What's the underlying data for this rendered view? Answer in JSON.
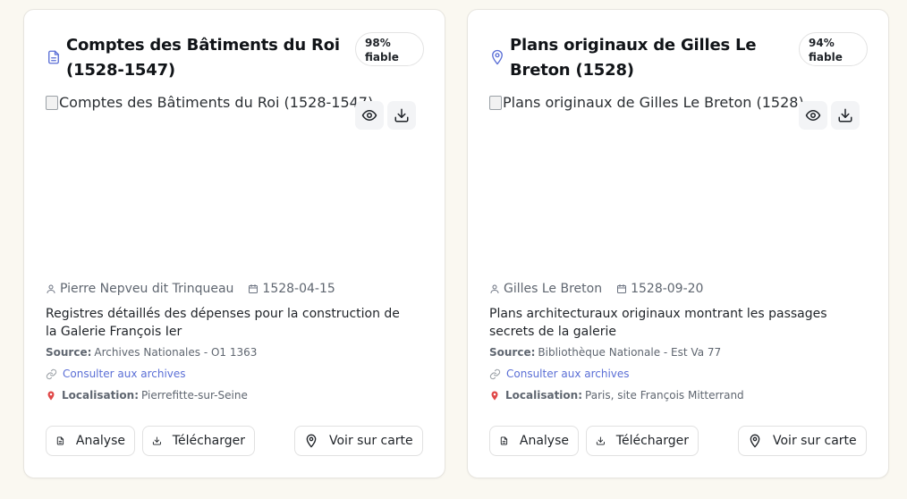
{
  "colors": {
    "page_bg": "#faf8f1",
    "card_bg": "#ffffff",
    "link": "#5b6fd6",
    "muted_text": "#5f6670",
    "location_pin": "#e04848"
  },
  "cards": [
    {
      "type_icon": "document-icon",
      "title": "Comptes des Bâtiments du Roi (1528-1547)",
      "badge_value": "98%",
      "badge_label": "fiable",
      "image_alt": "Comptes des Bâtiments du Roi (1528-1547)",
      "author": "Pierre Nepveu dit Trinqueau",
      "date": "1528-04-15",
      "description": "Registres détaillés des dépenses pour la construction de la Galerie François Ier",
      "source_label": "Source:",
      "source_value": "Archives Nationales - O1 1363",
      "archive_link": "Consulter aux archives",
      "location_label": "Localisation:",
      "location_value": "Pierrefitte-sur-Seine",
      "actions": {
        "analyse": "Analyse",
        "download": "Télécharger",
        "map": "Voir sur carte"
      }
    },
    {
      "type_icon": "map-pin-icon",
      "title": "Plans originaux de Gilles Le Breton (1528)",
      "badge_value": "94%",
      "badge_label": "fiable",
      "image_alt": "Plans originaux de Gilles Le Breton (1528)",
      "author": "Gilles Le Breton",
      "date": "1528-09-20",
      "description": "Plans architecturaux originaux montrant les passages secrets de la galerie",
      "source_label": "Source:",
      "source_value": "Bibliothèque Nationale - Est Va 77",
      "archive_link": "Consulter aux archives",
      "location_label": "Localisation:",
      "location_value": "Paris, site François Mitterrand",
      "actions": {
        "analyse": "Analyse",
        "download": "Télécharger",
        "map": "Voir sur carte"
      }
    }
  ]
}
